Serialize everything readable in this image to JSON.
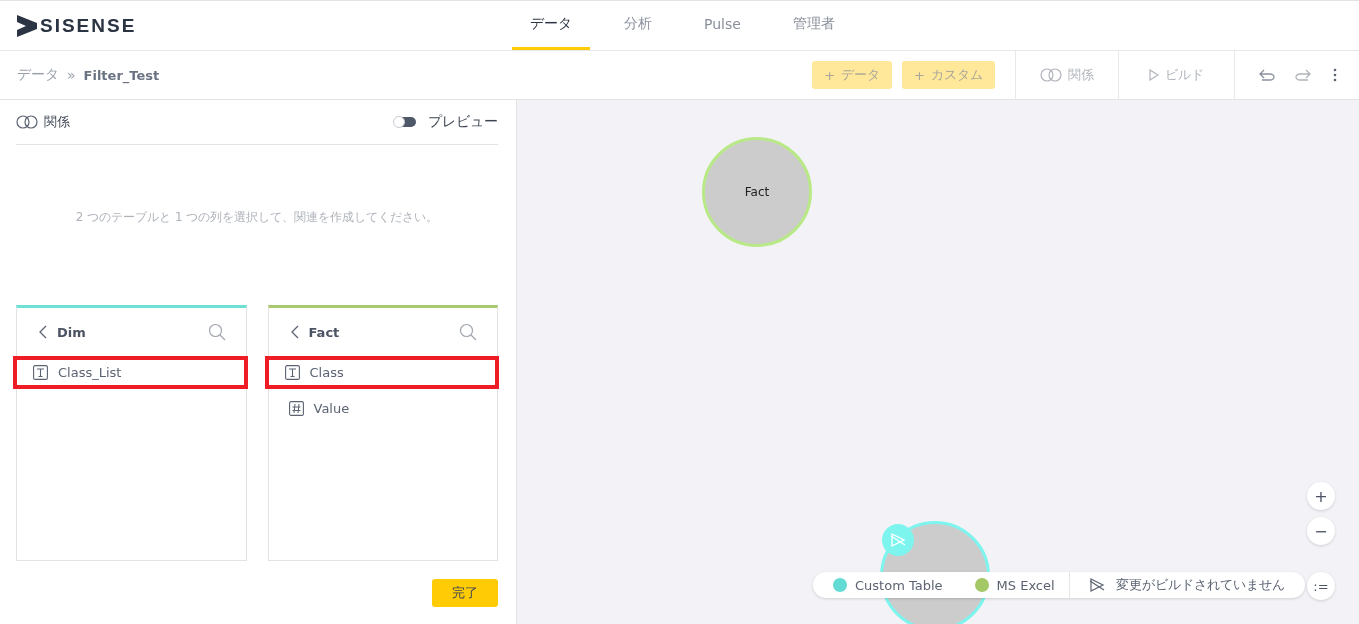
{
  "logo": {
    "text": "SISENSE"
  },
  "nav_tabs": [
    {
      "label": "データ",
      "selected": true
    },
    {
      "label": "分析",
      "selected": false
    },
    {
      "label": "Pulse",
      "selected": false
    },
    {
      "label": "管理者",
      "selected": false
    }
  ],
  "breadcrumb": {
    "root": "データ",
    "separator": "»",
    "current": "Filter_Test"
  },
  "toolbar": {
    "add_buttons": [
      {
        "icon": "+",
        "label": "データ",
        "disabled": true
      },
      {
        "icon": "+",
        "label": "カスタム",
        "disabled": true
      }
    ],
    "relations": "関係",
    "build": "ビルド"
  },
  "panel": {
    "title": "関係",
    "preview": {
      "label": "プレビュー",
      "on": false
    },
    "hint": "2 つのテーブルと 1 つの列を選択して、関連を作成してください。",
    "tables": [
      {
        "name": "Dim",
        "color": "#6ee0d6",
        "columns": [
          {
            "name": "Class_List",
            "kind": "text",
            "highlighted": true
          }
        ]
      },
      {
        "name": "Fact",
        "color": "#a9c96f",
        "columns": [
          {
            "name": "Class",
            "kind": "text",
            "highlighted": true
          },
          {
            "name": "Value",
            "kind": "number",
            "highlighted": false
          }
        ]
      }
    ],
    "done_button": "完了"
  },
  "canvas": {
    "nodes": [
      {
        "label": "Fact",
        "color": "#b8e986",
        "pending": false
      },
      {
        "color": "#7df5ee",
        "pending": true
      }
    ],
    "legend": [
      {
        "label": "Custom Table",
        "color": "#62dbd4"
      },
      {
        "label": "MS Excel",
        "color": "#a5c866"
      }
    ],
    "build_status": "変更がビルドされていません",
    "zoom_in": "+",
    "zoom_out": "−",
    "list_toggle": ":="
  }
}
